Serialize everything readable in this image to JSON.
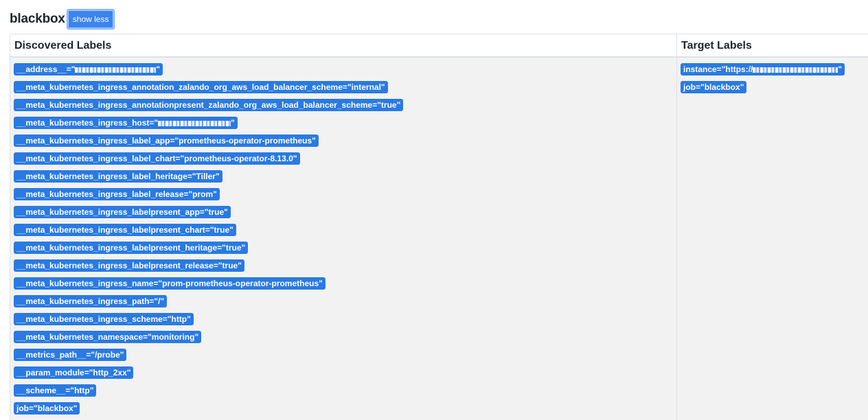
{
  "job": {
    "name": "blackbox",
    "toggle_label": "show less"
  },
  "table": {
    "headers": {
      "discovered": "Discovered Labels",
      "target": "Target Labels"
    },
    "discovered_labels": [
      {
        "prefix": "__address__=\"",
        "redacted": true,
        "suffix": "\""
      },
      {
        "text": "__meta_kubernetes_ingress_annotation_zalando_org_aws_load_balancer_scheme=\"internal\""
      },
      {
        "text": "__meta_kubernetes_ingress_annotationpresent_zalando_org_aws_load_balancer_scheme=\"true\""
      },
      {
        "prefix": "__meta_kubernetes_ingress_host=\"",
        "redacted": true,
        "suffix": "\""
      },
      {
        "text": "__meta_kubernetes_ingress_label_app=\"prometheus-operator-prometheus\""
      },
      {
        "text": "__meta_kubernetes_ingress_label_chart=\"prometheus-operator-8.13.0\""
      },
      {
        "text": "__meta_kubernetes_ingress_label_heritage=\"Tiller\""
      },
      {
        "text": "__meta_kubernetes_ingress_label_release=\"prom\""
      },
      {
        "text": "__meta_kubernetes_ingress_labelpresent_app=\"true\""
      },
      {
        "text": "__meta_kubernetes_ingress_labelpresent_chart=\"true\""
      },
      {
        "text": "__meta_kubernetes_ingress_labelpresent_heritage=\"true\""
      },
      {
        "text": "__meta_kubernetes_ingress_labelpresent_release=\"true\""
      },
      {
        "text": "__meta_kubernetes_ingress_name=\"prom-prometheus-operator-prometheus\""
      },
      {
        "text": "__meta_kubernetes_ingress_path=\"/\""
      },
      {
        "text": "__meta_kubernetes_ingress_scheme=\"http\""
      },
      {
        "text": "__meta_kubernetes_namespace=\"monitoring\""
      },
      {
        "text": "__metrics_path__=\"/probe\""
      },
      {
        "text": "__param_module=\"http_2xx\""
      },
      {
        "text": "__scheme__=\"http\""
      },
      {
        "text": "job=\"blackbox\""
      }
    ],
    "target_labels": [
      {
        "prefix": "instance=\"https://",
        "redacted": true,
        "suffix": "\""
      },
      {
        "text": "job=\"blackbox\""
      }
    ]
  },
  "colors": {
    "badge_bg": "#2a7ae2",
    "button_bg": "#3b84ee",
    "cell_bg": "#f2f2f2"
  }
}
